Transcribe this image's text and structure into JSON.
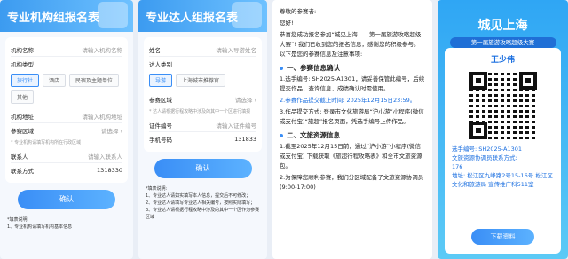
{
  "panel1": {
    "title": "专业机构组报名表",
    "org_name_label": "机构名称",
    "org_name_placeholder": "请输入机构名称",
    "org_type_label": "机构类型",
    "chips": [
      "旅行社",
      "酒店",
      "民宿及主题单位",
      "其他"
    ],
    "org_address_label": "机构地址",
    "org_address_placeholder": "请输入机构地址",
    "district_label": "参赛区域",
    "district_value": "请选择",
    "district_tip": "* 专业机构请填写机构所在行政区域",
    "contact_label": "联系人",
    "contact_placeholder": "请输入联系人",
    "phone_label": "联系方式",
    "phone_value": "1318330",
    "confirm_label": "确认",
    "note_title": "*填表说明:",
    "note_1": "1、专业机构请填写机构基本信息"
  },
  "panel2": {
    "title": "专业达人组报名表",
    "name_label": "姓名",
    "name_placeholder": "请输入导游姓名",
    "type_label": "达人类别",
    "chips": [
      "导游",
      "上海城市推荐官"
    ],
    "district_label": "参赛区域",
    "district_value": "请选择",
    "district_tip": "* 达人请根据行程攻略中涉及的其中一个区进行填报",
    "cert_label": "证件编号",
    "cert_placeholder": "请输入证件编号",
    "phone_label": "手机号码",
    "phone_value": "131833",
    "confirm_label": "确认",
    "note_title": "*填表说明:",
    "note_1": "1、专业达人请如实填写本人信息，提交后不可修改；",
    "note_2": "2、专业达人请填写专业达人相关编号，按照实际填写；",
    "note_3": "3、专业达人请根据行程攻略中涉及的其中一个区作为参赛区域"
  },
  "panel3": {
    "greeting": "尊敬的参赛者:",
    "hello": "您好!",
    "intro": "恭喜您成功报名参加“城见上海——第一届旅游攻略超级大赛”! 我们已收到您的报名信息，感谢您的积极参与。以下是您的参赛信息及注意事项:",
    "sec1": "一、参赛信息确认",
    "item1": "1.选手编号: SH2025-A1301，请妥善保管此编号，后续提交作品、查询信息、成绩确认时需使用。",
    "item2": "2.参赛作品提交截止时间: 2025年12月15日23:59。",
    "item3": "3.作品提交方式: 登录市文化旅游局“沪小游”小程序(微信或支付宝)“旅超”报名页面，凭选手编号上传作品。",
    "sec2": "二、文旅资源信息",
    "item4": "1.截至2025年12月15日前，通过“沪小游”小程序(微信或支付宝) 下载获取《旅超行程攻略表》和全市文旅资源包。",
    "item5": "2.为保障您顺利参赛，我们分区域配备了文旅资源协调员(9:00-17:00)"
  },
  "panel4": {
    "logo": "城见上海",
    "subtitle": "第一届旅游攻略超级大赛",
    "player_name": "王少伟",
    "player_no": "选手编号: SH2025-A1301",
    "coord_title": "文旅资源协调员联系方式:",
    "coord_phone": "176",
    "address": "地址: 松江区九峰路2号15-16号 松江区文化和旅游局 宣传推广科511室",
    "download_label": "下载资料"
  }
}
